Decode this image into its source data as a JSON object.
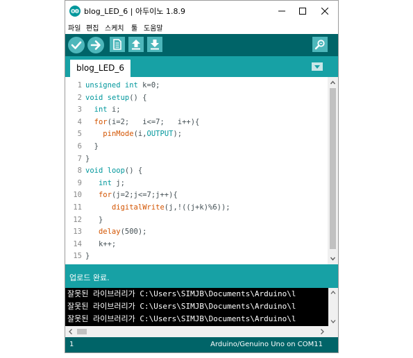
{
  "window": {
    "title": "blog_LED_6 | 아두이노 1.8.9",
    "logo_icon": "arduino-logo-icon",
    "controls": [
      "minimize-icon",
      "maximize-icon",
      "close-icon"
    ]
  },
  "menu": {
    "items": [
      {
        "label": "파일"
      },
      {
        "label": "편집"
      },
      {
        "label": "스케치"
      },
      {
        "label": "툴"
      },
      {
        "label": "도움말"
      }
    ]
  },
  "toolbar": {
    "buttons": [
      "verify-icon",
      "upload-icon",
      "new-icon",
      "open-icon",
      "save-icon"
    ],
    "serial_monitor_icon": "serial-monitor-icon"
  },
  "tabs": [
    {
      "label": "blog_LED_6"
    }
  ],
  "editor": {
    "line_numbers": [
      "1",
      "2",
      "3",
      "4",
      "5",
      "6",
      "7",
      "8",
      "9",
      "10",
      "11",
      "12",
      "13",
      "14",
      "15"
    ],
    "lines": [
      [
        {
          "t": "unsigned int",
          "c": "kw"
        },
        {
          "t": " k=0;",
          "c": ""
        }
      ],
      [
        {
          "t": "void",
          "c": "kw"
        },
        {
          "t": " ",
          "c": ""
        },
        {
          "t": "setup",
          "c": "kw"
        },
        {
          "t": "() {",
          "c": ""
        }
      ],
      [
        {
          "t": "  ",
          "c": ""
        },
        {
          "t": "int",
          "c": "kw"
        },
        {
          "t": " i;",
          "c": ""
        }
      ],
      [
        {
          "t": "  ",
          "c": ""
        },
        {
          "t": "for",
          "c": "fn"
        },
        {
          "t": "(i=2;   i<=7;   i++){",
          "c": ""
        }
      ],
      [
        {
          "t": "    ",
          "c": ""
        },
        {
          "t": "pinMode",
          "c": "fn"
        },
        {
          "t": "(i,",
          "c": ""
        },
        {
          "t": "OUTPUT",
          "c": "const"
        },
        {
          "t": ");",
          "c": ""
        }
      ],
      [
        {
          "t": "  }",
          "c": ""
        }
      ],
      [
        {
          "t": "}",
          "c": ""
        }
      ],
      [
        {
          "t": "void",
          "c": "kw"
        },
        {
          "t": " ",
          "c": ""
        },
        {
          "t": "loop",
          "c": "kw"
        },
        {
          "t": "() {",
          "c": ""
        }
      ],
      [
        {
          "t": "   ",
          "c": ""
        },
        {
          "t": "int",
          "c": "kw"
        },
        {
          "t": " j;",
          "c": ""
        }
      ],
      [
        {
          "t": "   ",
          "c": ""
        },
        {
          "t": "for",
          "c": "fn"
        },
        {
          "t": "(j=2;j<=7;j++){",
          "c": ""
        }
      ],
      [
        {
          "t": "      ",
          "c": ""
        },
        {
          "t": "digitalWrite",
          "c": "fn"
        },
        {
          "t": "(j,!((j+k)%6));",
          "c": ""
        }
      ],
      [
        {
          "t": "   }",
          "c": ""
        }
      ],
      [
        {
          "t": "   ",
          "c": ""
        },
        {
          "t": "delay",
          "c": "fn"
        },
        {
          "t": "(500);",
          "c": ""
        }
      ],
      [
        {
          "t": "   k++;",
          "c": ""
        }
      ],
      [
        {
          "t": "}",
          "c": ""
        }
      ]
    ]
  },
  "status": {
    "message": "업로드 완료."
  },
  "console": {
    "lines": [
      "잘못된 라이브러리가 C:\\Users\\SIMJB\\Documents\\Arduino\\l",
      "잘못된 라이브러리가 C:\\Users\\SIMJB\\Documents\\Arduino\\l",
      "잘못된 라이브러리가 C:\\Users\\SIMJB\\Documents\\Arduino\\l"
    ]
  },
  "footer": {
    "line_number": "1",
    "board": "Arduino/Genuino Uno on COM11"
  },
  "colors": {
    "toolbar": "#006468",
    "tabbar": "#17a1a5",
    "keyword": "#00979c",
    "function": "#d35400"
  }
}
